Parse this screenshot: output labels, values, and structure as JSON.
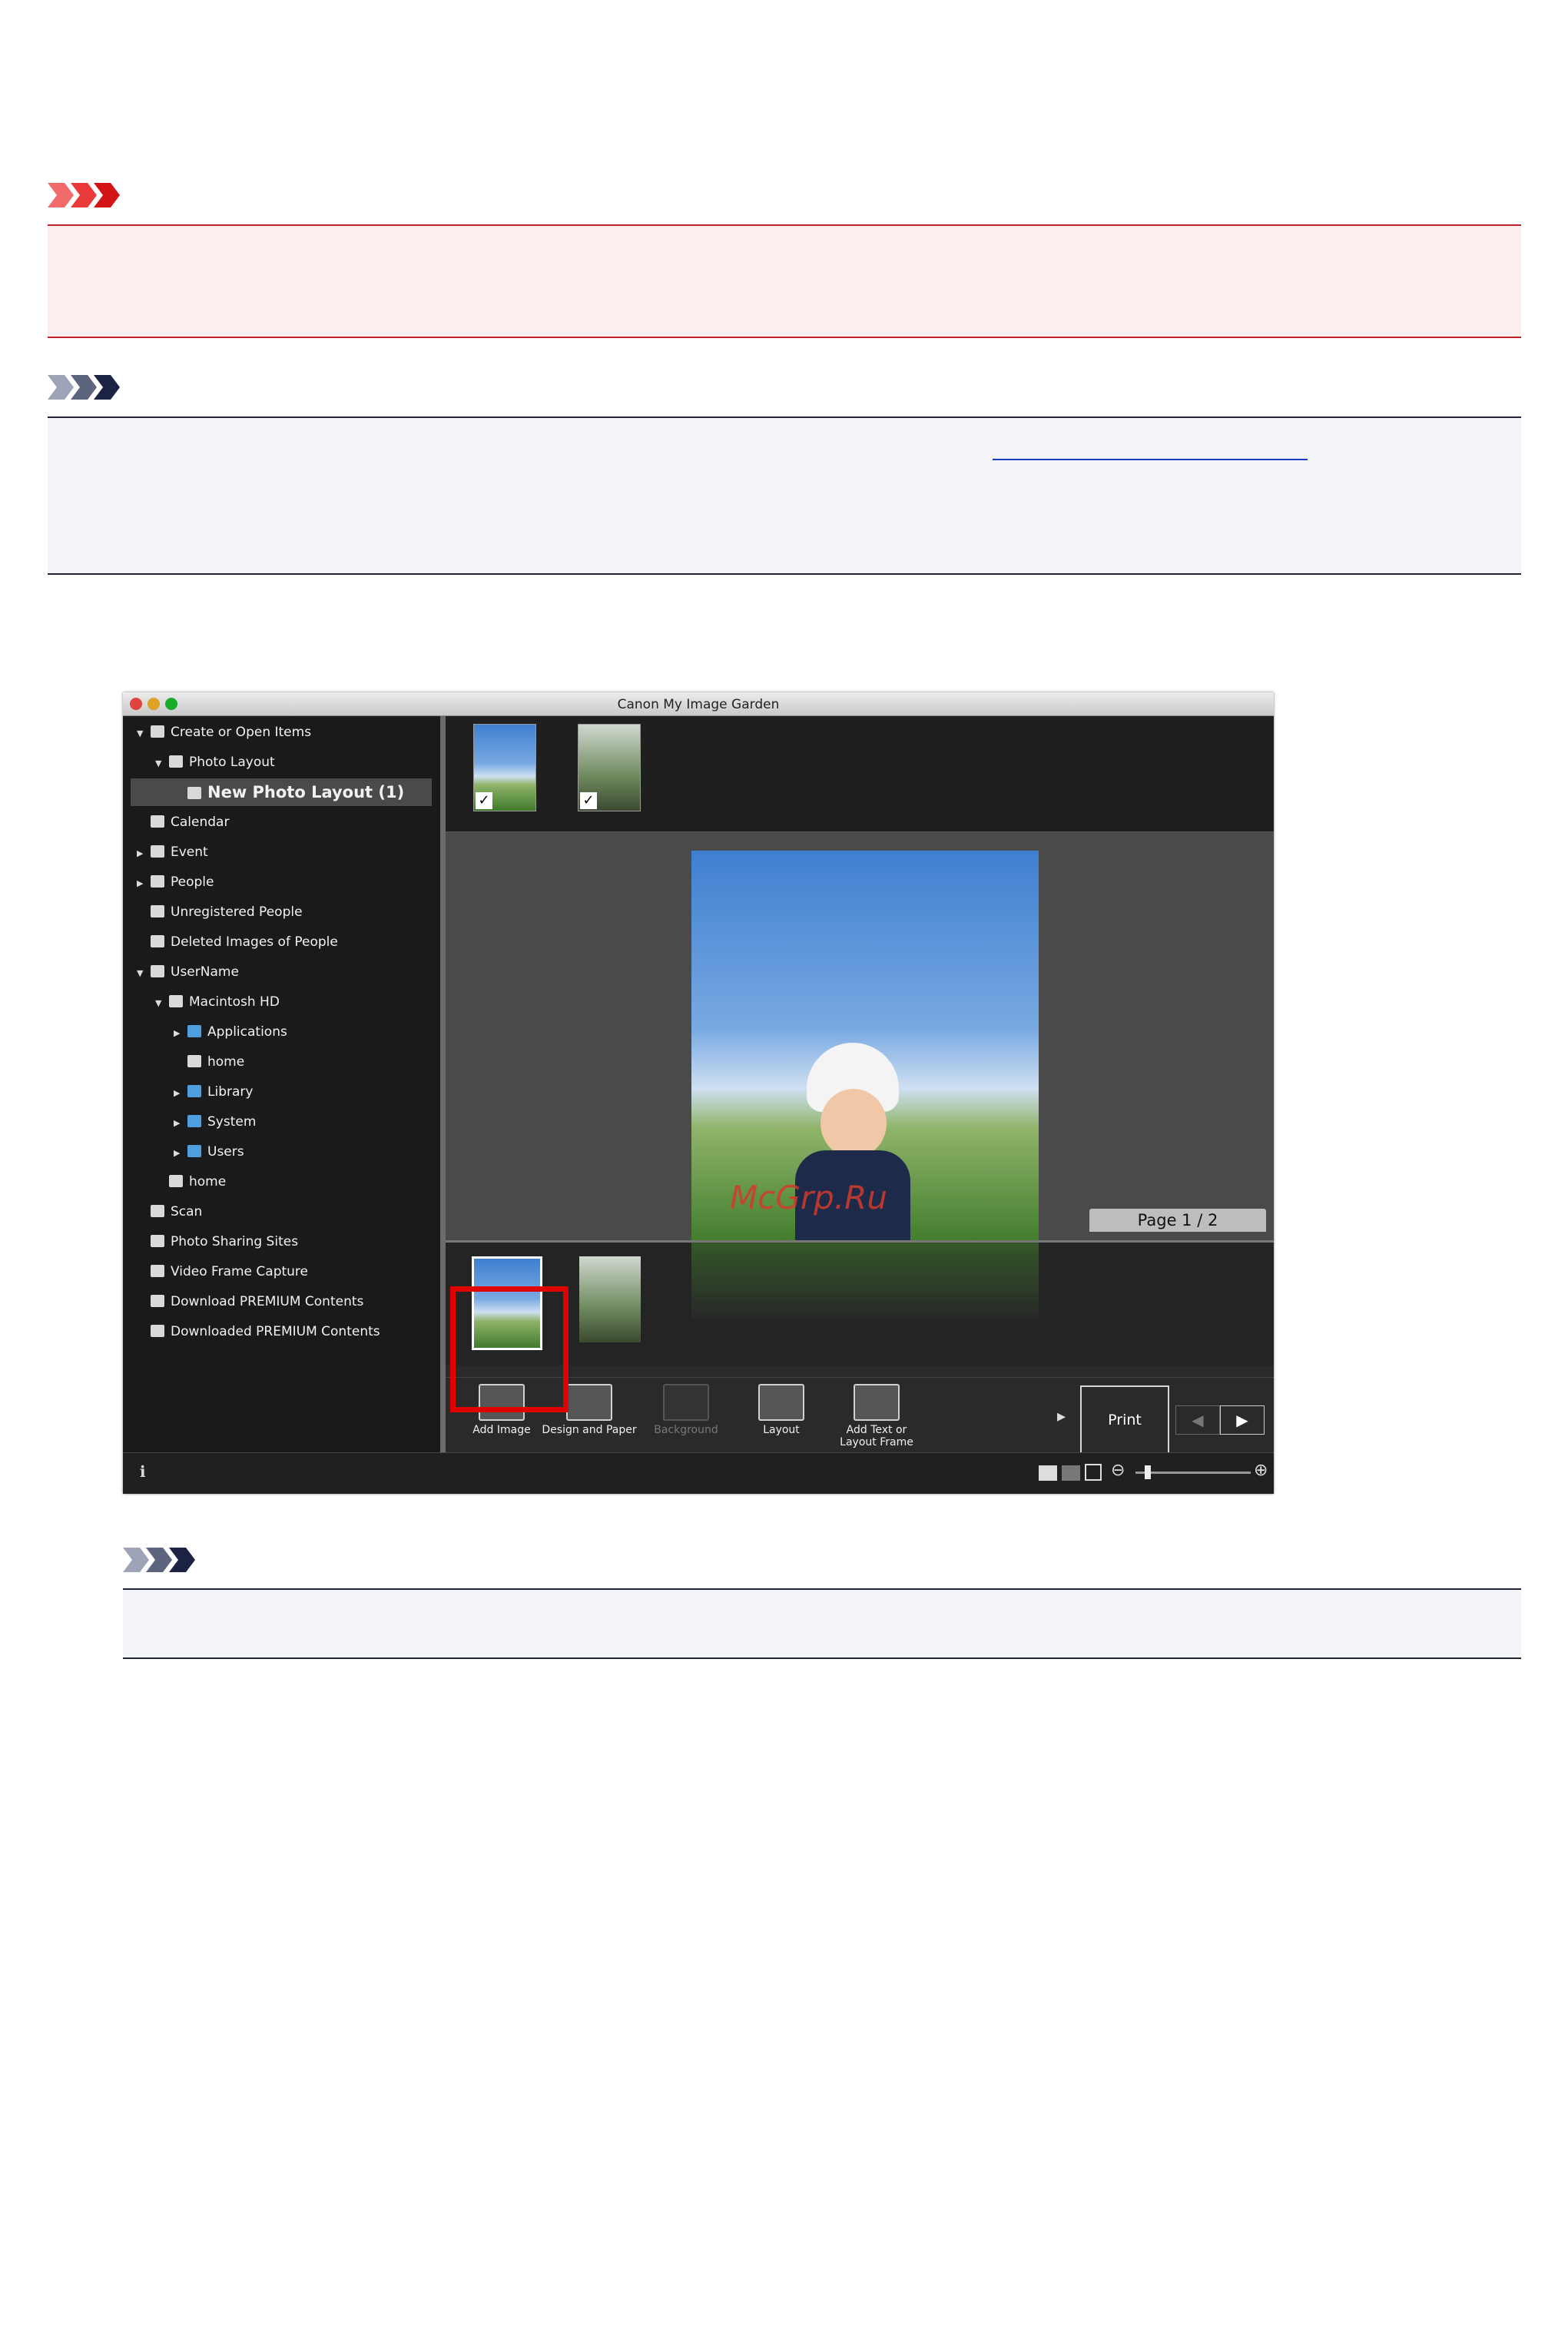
{
  "window": {
    "title": "Canon My Image Garden",
    "traffic_colors": [
      "#e0443e",
      "#dea123",
      "#1aab29"
    ]
  },
  "sidebar": {
    "items": [
      {
        "label": "Create or Open Items",
        "level": 0,
        "expander": "open"
      },
      {
        "label": "Photo Layout",
        "level": 1,
        "expander": "open"
      },
      {
        "label": "New Photo Layout (1)",
        "level": 2,
        "expander": "none",
        "selected": true
      },
      {
        "label": "Calendar",
        "level": 0,
        "expander": "none"
      },
      {
        "label": "Event",
        "level": 0,
        "expander": "closed"
      },
      {
        "label": "People",
        "level": 0,
        "expander": "closed"
      },
      {
        "label": "Unregistered People",
        "level": 0,
        "expander": "none"
      },
      {
        "label": "Deleted Images of People",
        "level": 0,
        "expander": "none"
      },
      {
        "label": "UserName",
        "level": 0,
        "expander": "open"
      },
      {
        "label": "Macintosh HD",
        "level": 1,
        "expander": "open"
      },
      {
        "label": "Applications",
        "level": 2,
        "expander": "closed",
        "folder": true
      },
      {
        "label": "home",
        "level": 2,
        "expander": "none"
      },
      {
        "label": "Library",
        "level": 2,
        "expander": "closed",
        "folder": true
      },
      {
        "label": "System",
        "level": 2,
        "expander": "closed",
        "folder": true
      },
      {
        "label": "Users",
        "level": 2,
        "expander": "closed",
        "folder": true
      },
      {
        "label": "home",
        "level": 1,
        "expander": "none"
      },
      {
        "label": "Scan",
        "level": 0,
        "expander": "none"
      },
      {
        "label": "Photo Sharing Sites",
        "level": 0,
        "expander": "none"
      },
      {
        "label": "Video Frame Capture",
        "level": 0,
        "expander": "none"
      },
      {
        "label": "Download PREMIUM Contents",
        "level": 0,
        "expander": "none"
      },
      {
        "label": "Downloaded PREMIUM Contents",
        "level": 0,
        "expander": "none"
      }
    ]
  },
  "canvas": {
    "page_label": "Page 1 / 2"
  },
  "toolbar": {
    "buttons": [
      {
        "label": "Add Image",
        "enabled": true
      },
      {
        "label": "Design and Paper",
        "enabled": true
      },
      {
        "label": "Background",
        "enabled": false
      },
      {
        "label": "Layout",
        "enabled": true
      },
      {
        "label": "Add Text or Layout Frame",
        "enabled": true
      }
    ],
    "print_label": "Print"
  },
  "watermark": "McGrp.Ru"
}
